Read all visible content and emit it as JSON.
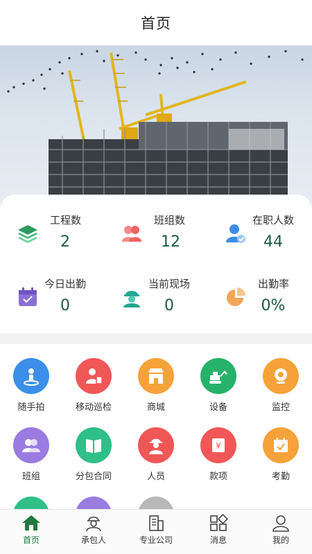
{
  "header": {
    "title": "首页"
  },
  "stats": [
    {
      "label": "工程数",
      "value": "2",
      "icon": "layers-icon",
      "color": "#3aa66b"
    },
    {
      "label": "班组数",
      "value": "12",
      "icon": "team-icon",
      "color": "#ef6f6f"
    },
    {
      "label": "在职人数",
      "value": "44",
      "icon": "user-check-icon",
      "color": "#3d8ee6"
    },
    {
      "label": "今日出勤",
      "value": "0",
      "icon": "calendar-check-icon",
      "color": "#8a6fd6"
    },
    {
      "label": "当前现场",
      "value": "0",
      "icon": "worker-icon",
      "color": "#2fb6a0"
    },
    {
      "label": "出勤率",
      "value": "0%",
      "icon": "pie-icon",
      "color": "#f2a65a"
    }
  ],
  "menu": [
    {
      "label": "随手拍",
      "icon": "camera-person-icon",
      "color": "#3b8fe8"
    },
    {
      "label": "移动巡检",
      "icon": "inspection-icon",
      "color": "#f05757"
    },
    {
      "label": "商城",
      "icon": "shop-icon",
      "color": "#f6a23a"
    },
    {
      "label": "设备",
      "icon": "excavator-icon",
      "color": "#27b26a"
    },
    {
      "label": "监控",
      "icon": "camera-icon",
      "color": "#f6a23a"
    },
    {
      "label": "班组",
      "icon": "group-icon",
      "color": "#9a7be0"
    },
    {
      "label": "分包合同",
      "icon": "book-icon",
      "color": "#2fbf87"
    },
    {
      "label": "人员",
      "icon": "person-helmet-icon",
      "color": "#f05757"
    },
    {
      "label": "款项",
      "icon": "payment-icon",
      "color": "#f05757"
    },
    {
      "label": "考勤",
      "icon": "calendar-icon",
      "color": "#f6a23a"
    }
  ],
  "menu_partial": [
    {
      "icon": "partial-icon-1",
      "color": "#2fbf87"
    },
    {
      "icon": "partial-icon-2",
      "color": "#9a7be0"
    },
    {
      "icon": "partial-icon-3",
      "color": "#b8b8b8"
    }
  ],
  "tabs": [
    {
      "label": "首页",
      "icon": "home-icon",
      "active": true
    },
    {
      "label": "承包人",
      "icon": "contractor-icon",
      "active": false
    },
    {
      "label": "专业公司",
      "icon": "building-icon",
      "active": false
    },
    {
      "label": "消息",
      "icon": "message-icon",
      "active": false
    },
    {
      "label": "我的",
      "icon": "profile-icon",
      "active": false
    }
  ],
  "colors": {
    "accent": "#1f7a3f",
    "value": "#1c5c3c"
  }
}
